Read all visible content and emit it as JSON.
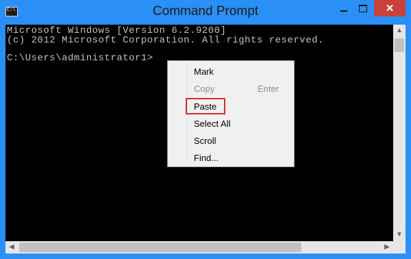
{
  "window": {
    "title": "Command Prompt",
    "icon_text": "C:\\",
    "controls": {
      "minimize": "minimize-icon",
      "maximize": "maximize-icon",
      "close": "close-icon"
    }
  },
  "console": {
    "lines": [
      "Microsoft Windows [Version 6.2.9200]",
      "(c) 2012 Microsoft Corporation. All rights reserved.",
      "C:\\Users\\administrator1>"
    ],
    "background": "#000000",
    "foreground": "#c0c0c0"
  },
  "context_menu": {
    "items": [
      {
        "label": "Mark",
        "enabled": true
      },
      {
        "label": "Copy",
        "enabled": false,
        "shortcut": "Enter"
      },
      {
        "label": "Paste",
        "enabled": true,
        "highlighted": true
      },
      {
        "label": "Select All",
        "enabled": true
      },
      {
        "label": "Scroll",
        "enabled": true
      },
      {
        "label": "Find...",
        "enabled": true
      }
    ],
    "highlight_color": "#d9282f"
  },
  "colors": {
    "titlebar": "#2a8ff6",
    "close_button": "#c7423a"
  }
}
